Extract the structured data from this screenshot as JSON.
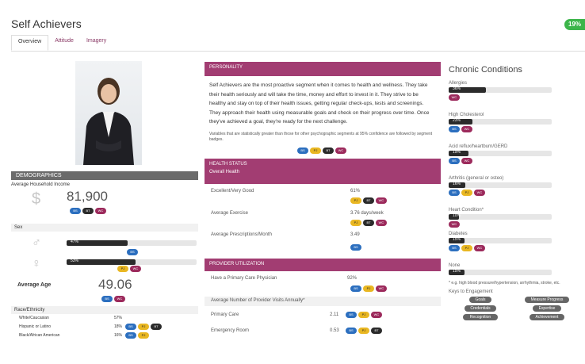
{
  "app": {
    "title": "Self Achievers",
    "progress_badge": "19%"
  },
  "tabs": [
    "Overview",
    "Attitude",
    "Imagery"
  ],
  "demographics": {
    "header": "DEMOGRAPHICS",
    "income_label": "Average Household Income",
    "income_value": "81,900",
    "income_icon": "dollar-sign-icon",
    "sex_label": "Sex",
    "male_pct": "47%",
    "female_pct": "53%",
    "male_fraction": 0.47,
    "female_fraction": 0.53,
    "age_label": "Average Age",
    "age_value": "49.06",
    "race_label": "Race/Ethnicity",
    "race_rows": [
      {
        "label": "White/Caucasian",
        "value": "57%"
      },
      {
        "label": "Hispanic or Latino",
        "value": "18%"
      },
      {
        "label": "Black/African American",
        "value": "16%"
      }
    ]
  },
  "personality": {
    "header": "PERSONALITY",
    "text": "Self Achievers are the most proactive segment when it comes to health and wellness. They take their health seriously and will take the time, money and effort to invest in it. They strive to be healthy and stay on top of their health issues, getting regular check-ups, tests and screenings. They approach their health using measurable goals and check on their progress over time. Once they've achieved a goal, they're ready for the next challenge.",
    "note": "Variables that are statistically greater than those for other psychographic segments at 95% confidence are followed by segment badges."
  },
  "health_status": {
    "header": "HEALTH STATUS",
    "subheader": "Overall Health",
    "rows": [
      {
        "label": "Excellent/Very Good",
        "value": "61%"
      },
      {
        "label": "Average Exercise",
        "value": "3.76 days/week"
      },
      {
        "label": "Average Prescriptions/Month",
        "value": "3.49"
      }
    ]
  },
  "provider": {
    "header": "PROVIDER UTILIZATION",
    "rows": [
      {
        "label": "Have a Primary Care Physician",
        "value": "92%"
      },
      {
        "label": "Average Number of Provider Visits Annually*",
        "value": ""
      },
      {
        "label": "Primary Care",
        "value": "2.11"
      },
      {
        "label": "Emergency Room",
        "value": "0.53"
      }
    ]
  },
  "chronic": {
    "title": "Chronic Conditions",
    "items": [
      {
        "label": "Allergies",
        "pct": "36%",
        "fraction": 0.36
      },
      {
        "label": "High Cholesterol",
        "pct": "23%",
        "fraction": 0.23
      },
      {
        "label": "Acid reflux/heartburn/GERD",
        "pct": "19%",
        "fraction": 0.19
      },
      {
        "label": "Arthritis (general or osteo)",
        "pct": "16%",
        "fraction": 0.16
      },
      {
        "label": "Heart Condition*",
        "pct": "10%",
        "fraction": 0.1
      },
      {
        "label": "Diabetes",
        "pct": "15%",
        "fraction": 0.15
      },
      {
        "label": "None",
        "pct": "15%",
        "fraction": 0.15
      }
    ],
    "footnote": "* e.g. high blood pressure/hypertension, arrhythmia, stroke, etc.",
    "keys_title": "Keys to Engagement",
    "keys": [
      "Goals",
      "Measure Progress",
      "Credentials",
      "Expertise",
      "Recognition",
      "Achievement"
    ]
  },
  "colors": {
    "accent": "#a23d72",
    "badge_green": "#3cb54a",
    "dark": "#2b2b2b",
    "chip_blue": "#2c6fbf",
    "chip_yellow": "#e9b722",
    "chip_black": "#2b2b2b",
    "chip_maroon": "#9c2a5c"
  }
}
